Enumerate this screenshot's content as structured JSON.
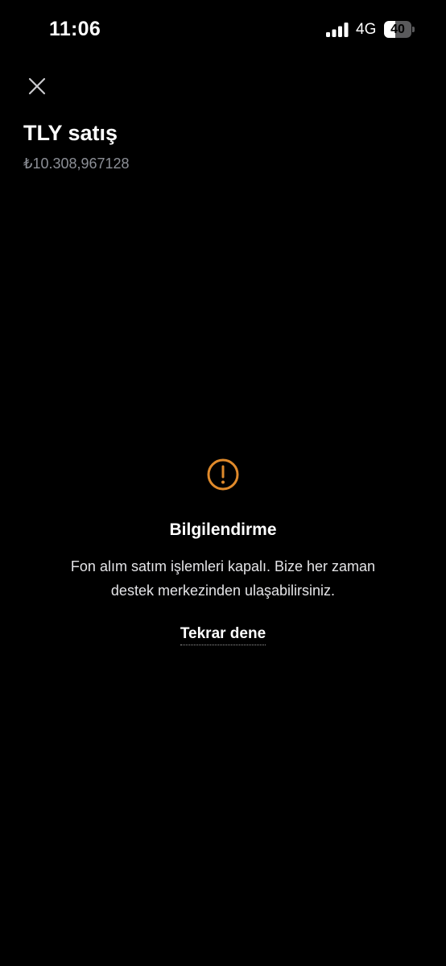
{
  "status_bar": {
    "time": "11:06",
    "network": "4G",
    "battery_level": "40",
    "signal_bars_active": 4
  },
  "header": {
    "close_icon": "close-icon",
    "title": "TLY satış",
    "balance": "₺10.308,967128"
  },
  "notice": {
    "icon": "warning-icon",
    "title": "Bilgilendirme",
    "message": "Fon alım satım işlemleri kapalı. Bize her zaman destek merkezinden ulaşabilirsiniz.",
    "retry_label": "Tekrar dene"
  },
  "colors": {
    "background": "#000000",
    "warning_accent": "#e08a2b",
    "muted_text": "#8c8f96"
  }
}
